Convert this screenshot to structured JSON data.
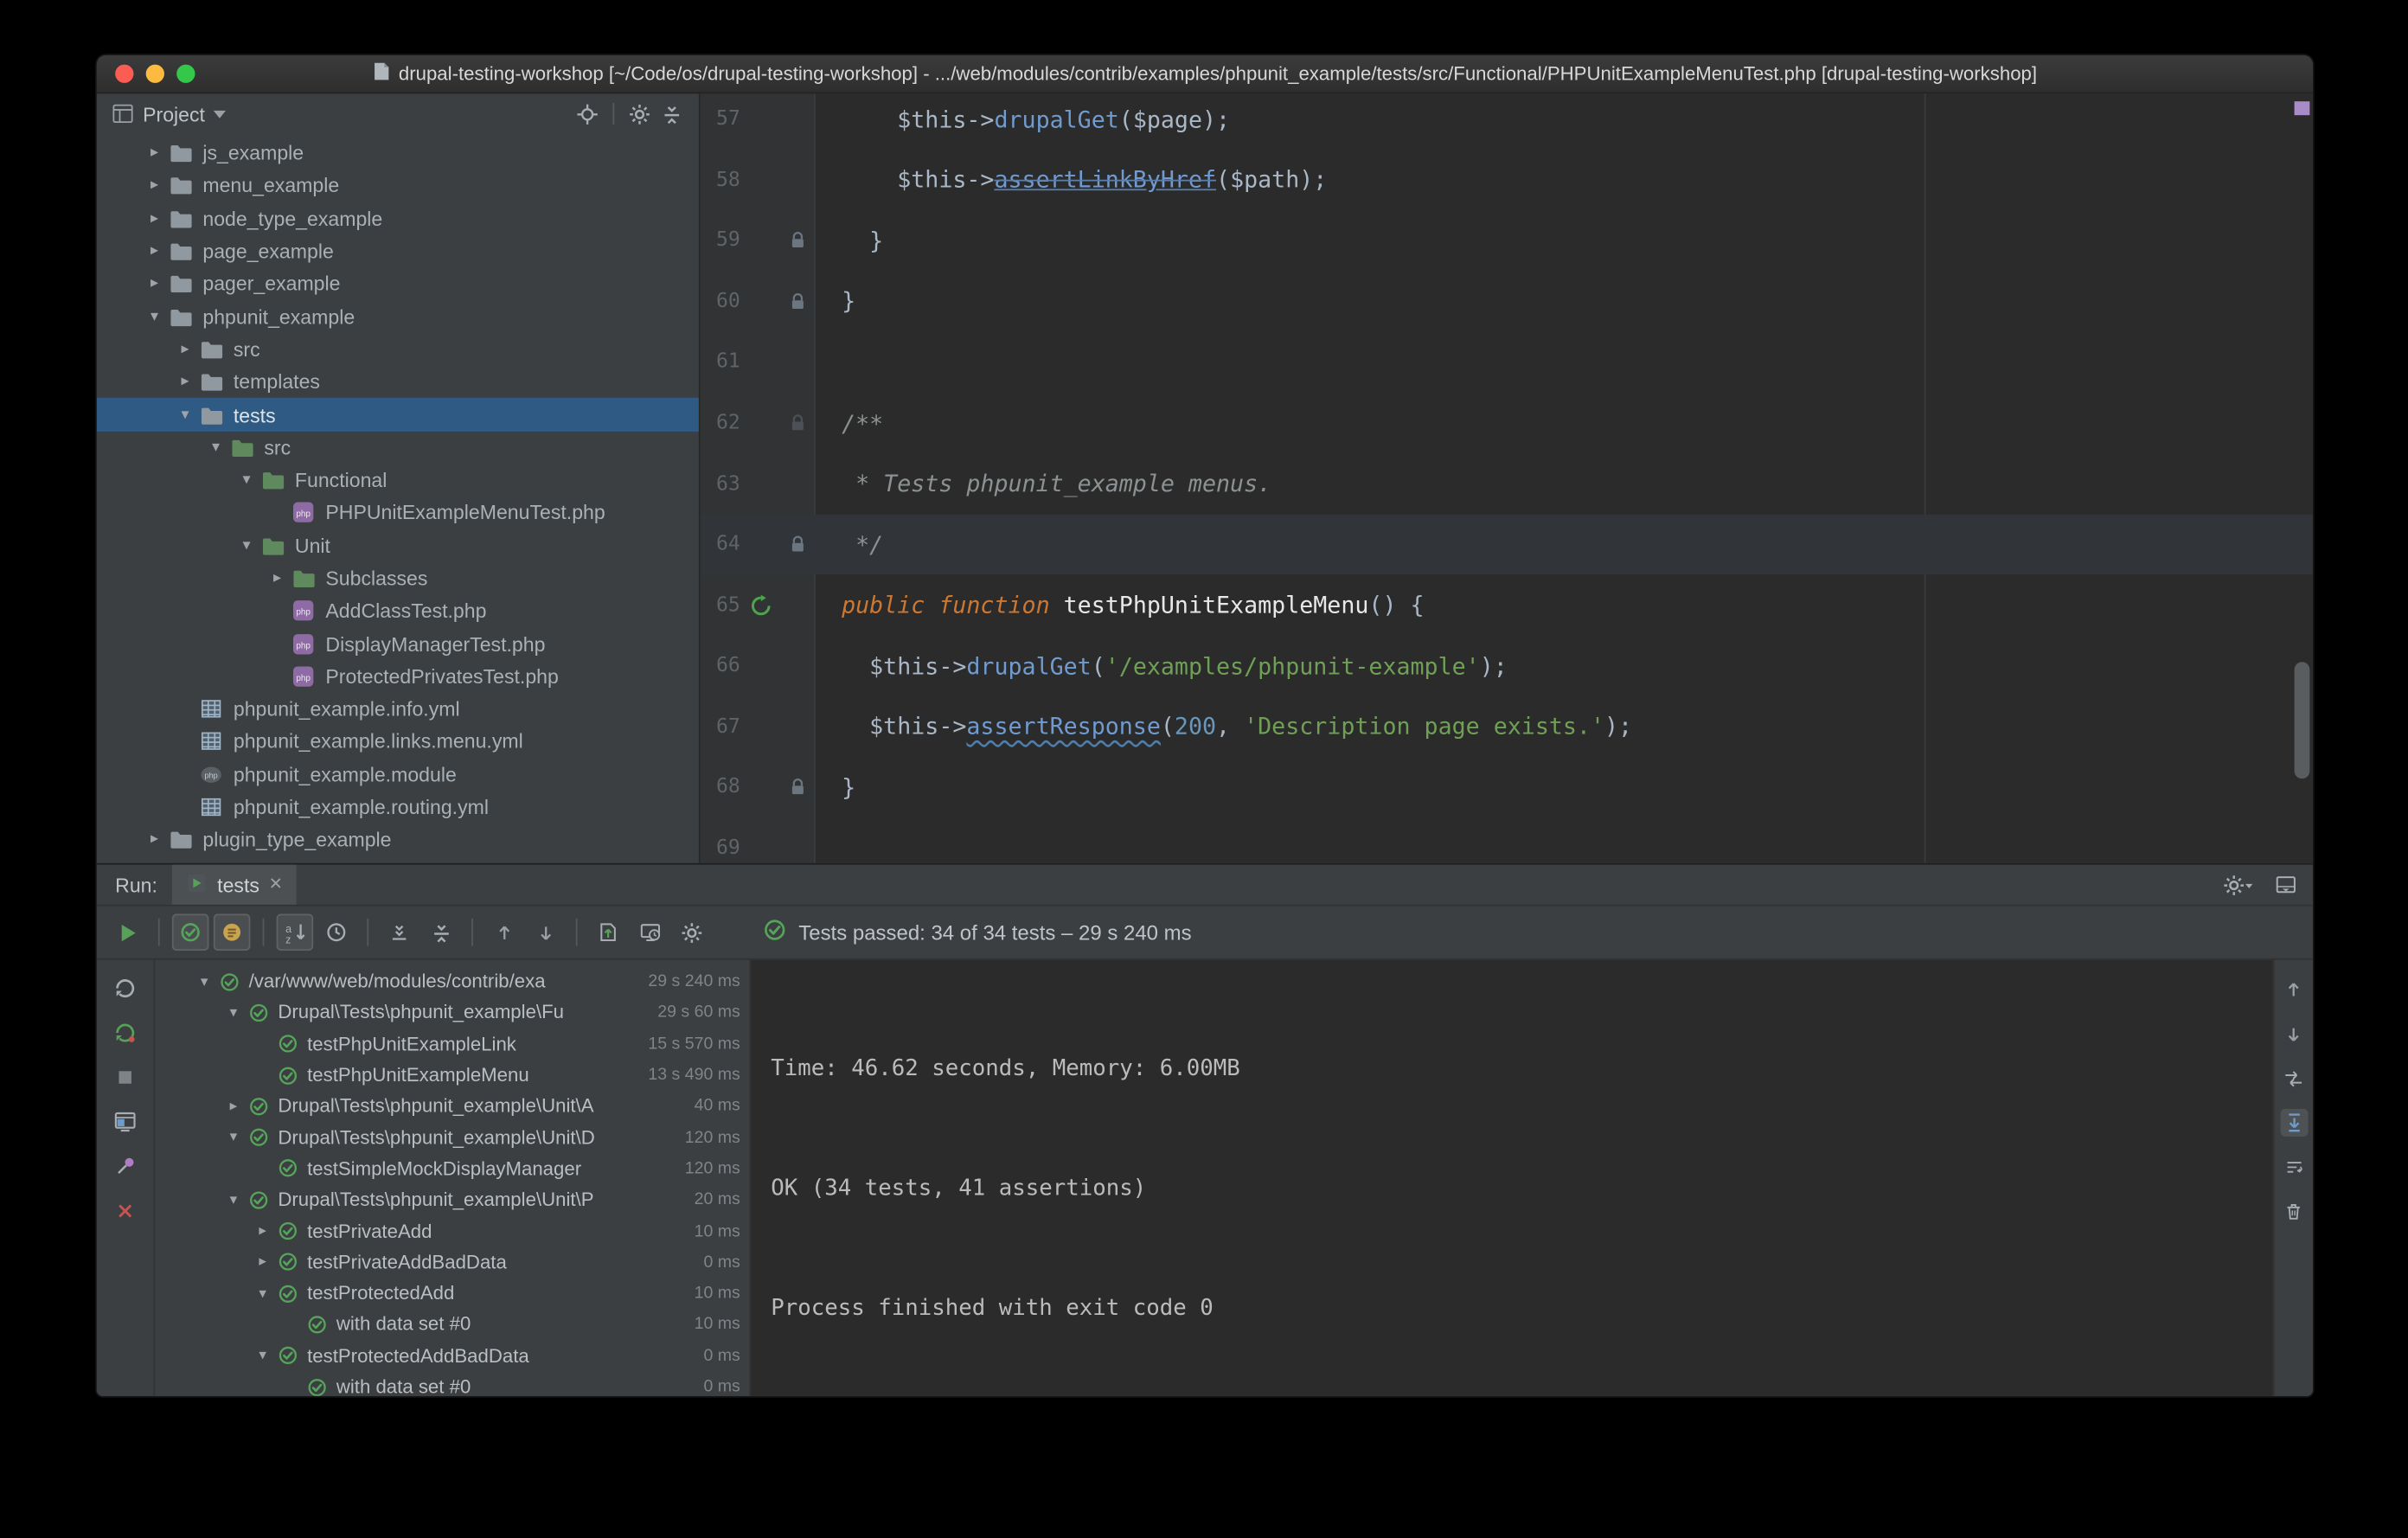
{
  "window": {
    "title": "drupal-testing-workshop [~/Code/os/drupal-testing-workshop] - .../web/modules/contrib/examples/phpunit_example/tests/src/Functional/PHPUnitExampleMenuTest.php [drupal-testing-workshop]"
  },
  "colors": {
    "panel_bg": "#3C3F41",
    "editor_bg": "#2B2B2B",
    "selection_blue": "#2F5A83",
    "passed_green": "#56A45C",
    "keyword_orange": "#CC7832",
    "string_green": "#6FA056",
    "method_blue": "#6F9BD1",
    "error_stripe_purple": "#A98BC9",
    "close_red": "#C75450"
  },
  "project_panel": {
    "header": {
      "title": "Project"
    },
    "tree": [
      {
        "label": "js_example",
        "icon": "folder",
        "level": 0,
        "state": "collapsed"
      },
      {
        "label": "menu_example",
        "icon": "folder",
        "level": 0,
        "state": "collapsed"
      },
      {
        "label": "node_type_example",
        "icon": "folder",
        "level": 0,
        "state": "collapsed"
      },
      {
        "label": "page_example",
        "icon": "folder",
        "level": 0,
        "state": "collapsed"
      },
      {
        "label": "pager_example",
        "icon": "folder",
        "level": 0,
        "state": "collapsed"
      },
      {
        "label": "phpunit_example",
        "icon": "folder",
        "level": 0,
        "state": "expanded"
      },
      {
        "label": "src",
        "icon": "folder",
        "level": 1,
        "state": "collapsed"
      },
      {
        "label": "templates",
        "icon": "folder",
        "level": 1,
        "state": "collapsed"
      },
      {
        "label": "tests",
        "icon": "folder",
        "level": 1,
        "state": "expanded",
        "selected": true
      },
      {
        "label": "src",
        "icon": "folder-test",
        "level": 2,
        "state": "expanded"
      },
      {
        "label": "Functional",
        "icon": "folder-test",
        "level": 3,
        "state": "expanded"
      },
      {
        "label": "PHPUnitExampleMenuTest.php",
        "icon": "php-test",
        "level": 4
      },
      {
        "label": "Unit",
        "icon": "folder-test",
        "level": 3,
        "state": "expanded"
      },
      {
        "label": "Subclasses",
        "icon": "folder-test",
        "level": 4,
        "state": "collapsed"
      },
      {
        "label": "AddClassTest.php",
        "icon": "php-test",
        "level": 4
      },
      {
        "label": "DisplayManagerTest.php",
        "icon": "php-test",
        "level": 4
      },
      {
        "label": "ProtectedPrivatesTest.php",
        "icon": "php-test",
        "level": 4
      },
      {
        "label": "phpunit_example.info.yml",
        "icon": "yml",
        "level": 1
      },
      {
        "label": "phpunit_example.links.menu.yml",
        "icon": "yml",
        "level": 1
      },
      {
        "label": "phpunit_example.module",
        "icon": "php-file",
        "level": 1
      },
      {
        "label": "phpunit_example.routing.yml",
        "icon": "yml",
        "level": 1
      },
      {
        "label": "plugin_type_example",
        "icon": "folder",
        "level": 0,
        "state": "collapsed"
      }
    ]
  },
  "editor": {
    "lines": [
      {
        "num": "57",
        "segs": [
          [
            "plain",
            "      $this->"
          ],
          [
            "method",
            "drupalGet"
          ],
          [
            "plain",
            "($page);"
          ]
        ]
      },
      {
        "num": "58",
        "segs": [
          [
            "plain",
            "      $this->"
          ],
          [
            "dep",
            "assertLinkByHref"
          ],
          [
            "plain",
            "($path);"
          ]
        ]
      },
      {
        "num": "59",
        "lock": "y",
        "segs": [
          [
            "plain",
            "    }"
          ]
        ]
      },
      {
        "num": "60",
        "lock": "y",
        "segs": [
          [
            "plain",
            "  }"
          ]
        ]
      },
      {
        "num": "61",
        "segs": []
      },
      {
        "num": "62",
        "lock": "faint",
        "segs": [
          [
            "cmt",
            "  /**"
          ]
        ]
      },
      {
        "num": "63",
        "segs": [
          [
            "cmt",
            "   * Tests phpunit_example menus."
          ]
        ]
      },
      {
        "num": "64",
        "lock": "y",
        "hl": true,
        "segs": [
          [
            "cmt",
            "   */"
          ]
        ]
      },
      {
        "num": "65",
        "run": true,
        "segs": [
          [
            "plain",
            "  "
          ],
          [
            "kw",
            "public function"
          ],
          [
            "plain",
            " "
          ],
          [
            "fn",
            "testPhpUnitExampleMenu"
          ],
          [
            "plain",
            "() {"
          ]
        ]
      },
      {
        "num": "66",
        "segs": [
          [
            "plain",
            "    $this->"
          ],
          [
            "method",
            "drupalGet"
          ],
          [
            "plain",
            "("
          ],
          [
            "str",
            "'/examples/phpunit-example'"
          ],
          [
            "plain",
            ");"
          ]
        ]
      },
      {
        "num": "67",
        "segs": [
          [
            "plain",
            "    $this->"
          ],
          [
            "warn",
            "assertResponse"
          ],
          [
            "plain",
            "("
          ],
          [
            "num",
            "200"
          ],
          [
            "plain",
            ", "
          ],
          [
            "str",
            "'Description page exists.'"
          ],
          [
            "plain",
            ");"
          ]
        ]
      },
      {
        "num": "68",
        "lock": "y",
        "segs": [
          [
            "plain",
            "  }"
          ]
        ]
      },
      {
        "num": "69",
        "segs": []
      }
    ]
  },
  "run_panel": {
    "header": {
      "label": "Run:",
      "tab_label": "tests",
      "icons": [
        "gear-caret",
        "hide-panel"
      ]
    },
    "toolbar": {
      "buttons": [
        {
          "name": "run"
        },
        {
          "name": "show-passed",
          "pressed": true
        },
        {
          "name": "show-ignored",
          "pressed": true
        },
        {
          "name": "sort-alphabetically",
          "pressed": true
        },
        {
          "name": "sort-by-duration"
        },
        {
          "name": "expand-all"
        },
        {
          "name": "collapse-all"
        },
        {
          "name": "previous-failed"
        },
        {
          "name": "next-failed"
        },
        {
          "name": "import-test-results"
        },
        {
          "name": "test-history"
        },
        {
          "name": "run-settings"
        }
      ],
      "status_text": "Tests passed: 34 of 34 tests – 29 s 240 ms"
    },
    "left_strip": [
      {
        "name": "rerun"
      },
      {
        "name": "rerun-failed"
      },
      {
        "name": "stop"
      },
      {
        "name": "restore-layout"
      },
      {
        "name": "pin-tab"
      },
      {
        "name": "close"
      }
    ],
    "right_strip": [
      {
        "name": "scroll-up"
      },
      {
        "name": "scroll-down"
      },
      {
        "name": "navigate-stacktrace"
      },
      {
        "name": "scroll-to-end",
        "selected": true
      },
      {
        "name": "soft-wrap"
      },
      {
        "name": "clear-all"
      }
    ],
    "test_tree": [
      {
        "label": "/var/www/web/modules/contrib/exa",
        "duration": "29 s 240 ms",
        "level": 0,
        "state": "expanded",
        "status": "passed"
      },
      {
        "label": "Drupal\\Tests\\phpunit_example\\Fu",
        "duration": "29 s 60 ms",
        "level": 1,
        "state": "expanded",
        "status": "passed"
      },
      {
        "label": "testPhpUnitExampleLink",
        "duration": "15 s 570 ms",
        "level": 2,
        "status": "passed"
      },
      {
        "label": "testPhpUnitExampleMenu",
        "duration": "13 s 490 ms",
        "level": 2,
        "status": "passed"
      },
      {
        "label": "Drupal\\Tests\\phpunit_example\\Unit\\A",
        "duration": "40 ms",
        "level": 1,
        "state": "collapsed",
        "status": "passed"
      },
      {
        "label": "Drupal\\Tests\\phpunit_example\\Unit\\D",
        "duration": "120 ms",
        "level": 1,
        "state": "expanded",
        "status": "passed"
      },
      {
        "label": "testSimpleMockDisplayManager",
        "duration": "120 ms",
        "level": 2,
        "status": "passed"
      },
      {
        "label": "Drupal\\Tests\\phpunit_example\\Unit\\P",
        "duration": "20 ms",
        "level": 1,
        "state": "expanded",
        "status": "passed"
      },
      {
        "label": "testPrivateAdd",
        "duration": "10 ms",
        "level": 2,
        "state": "collapsed",
        "status": "passed"
      },
      {
        "label": "testPrivateAddBadData",
        "duration": "0 ms",
        "level": 2,
        "state": "collapsed",
        "status": "passed"
      },
      {
        "label": "testProtectedAdd",
        "duration": "10 ms",
        "level": 2,
        "state": "expanded",
        "status": "passed"
      },
      {
        "label": "with data set #0",
        "duration": "10 ms",
        "level": 3,
        "status": "passed"
      },
      {
        "label": "testProtectedAddBadData",
        "duration": "0 ms",
        "level": 2,
        "state": "expanded",
        "status": "passed"
      },
      {
        "label": "with data set #0",
        "duration": "0 ms",
        "level": 3,
        "status": "passed"
      }
    ],
    "console": {
      "lines": [
        "",
        "",
        "Time: 46.62 seconds, Memory: 6.00MB",
        "",
        "",
        "OK (34 tests, 41 assertions)",
        "",
        "",
        "Process finished with exit code 0"
      ]
    }
  }
}
